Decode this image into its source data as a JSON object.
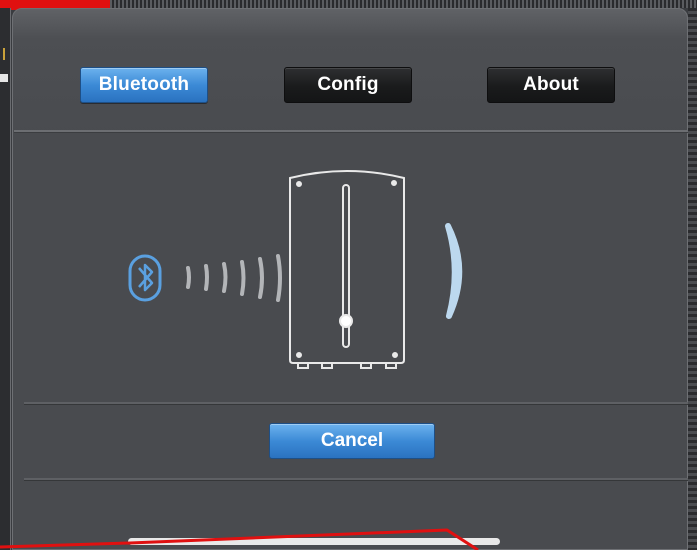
{
  "tabs": {
    "bluetooth_label": "Bluetooth",
    "config_label": "Config",
    "about_label": "About",
    "active": "Bluetooth"
  },
  "actions": {
    "cancel_label": "Cancel"
  },
  "icons": {
    "bluetooth": "bluetooth-icon",
    "signal": "signal-waves-icon",
    "device": "device-icon",
    "response": "response-arc-icon"
  },
  "colors": {
    "accent_blue": "#3c8ad6",
    "panel_bg": "#494b4f",
    "inactive_button": "#1a1b1c",
    "annotation_red": "#e01010"
  }
}
